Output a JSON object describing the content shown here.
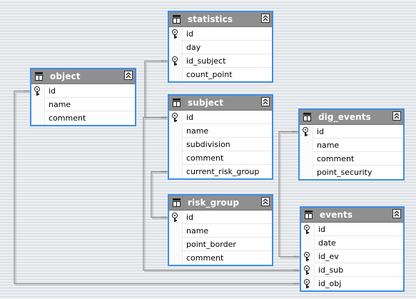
{
  "diagram": {
    "tables": [
      {
        "id": "statistics",
        "title": "statistics",
        "collapse_icon": "double-chevron-up-icon",
        "fields": [
          {
            "name": "id",
            "key": true
          },
          {
            "name": "day",
            "key": false
          },
          {
            "name": "id_subject",
            "key": true
          },
          {
            "name": "count_point",
            "key": false
          }
        ]
      },
      {
        "id": "object",
        "title": "object",
        "collapse_icon": "double-chevron-up-icon",
        "fields": [
          {
            "name": "id",
            "key": true
          },
          {
            "name": "name",
            "key": false
          },
          {
            "name": "comment",
            "key": false
          }
        ]
      },
      {
        "id": "subject",
        "title": "subject",
        "collapse_icon": "double-chevron-up-icon",
        "fields": [
          {
            "name": "id",
            "key": true
          },
          {
            "name": "name",
            "key": false
          },
          {
            "name": "subdivision",
            "key": false
          },
          {
            "name": "comment",
            "key": false
          },
          {
            "name": "current_risk_group",
            "key": false
          }
        ]
      },
      {
        "id": "dig_events",
        "title": "dig_events",
        "collapse_icon": "double-chevron-up-icon",
        "fields": [
          {
            "name": "id",
            "key": true
          },
          {
            "name": "name",
            "key": false
          },
          {
            "name": "comment",
            "key": false
          },
          {
            "name": "point_security",
            "key": false
          }
        ]
      },
      {
        "id": "risk_group",
        "title": "risk_group",
        "collapse_icon": "double-chevron-up-icon",
        "fields": [
          {
            "name": "id",
            "key": true
          },
          {
            "name": "name",
            "key": false
          },
          {
            "name": "point_border",
            "key": false
          },
          {
            "name": "comment",
            "key": false
          }
        ]
      },
      {
        "id": "events",
        "title": "events",
        "collapse_icon": "double-chevron-up-icon",
        "fields": [
          {
            "name": "id",
            "key": true
          },
          {
            "name": "date",
            "key": false
          },
          {
            "name": "id_ev",
            "key": true
          },
          {
            "name": "id_sub",
            "key": true
          },
          {
            "name": "id_obj",
            "key": true
          }
        ]
      }
    ],
    "relationships": [
      {
        "from": "statistics.id_subject",
        "to": "subject.id"
      },
      {
        "from": "subject.current_risk_group",
        "to": "risk_group.id"
      },
      {
        "from": "events.id_ev",
        "to": "dig_events.id"
      },
      {
        "from": "events.id_sub",
        "to": "subject.id"
      },
      {
        "from": "events.id_obj",
        "to": "object.id"
      }
    ],
    "colors": {
      "header_bg": "#8f8f8f",
      "selection_border": "#3c8ee8",
      "connector": "#7a7a7a"
    }
  }
}
